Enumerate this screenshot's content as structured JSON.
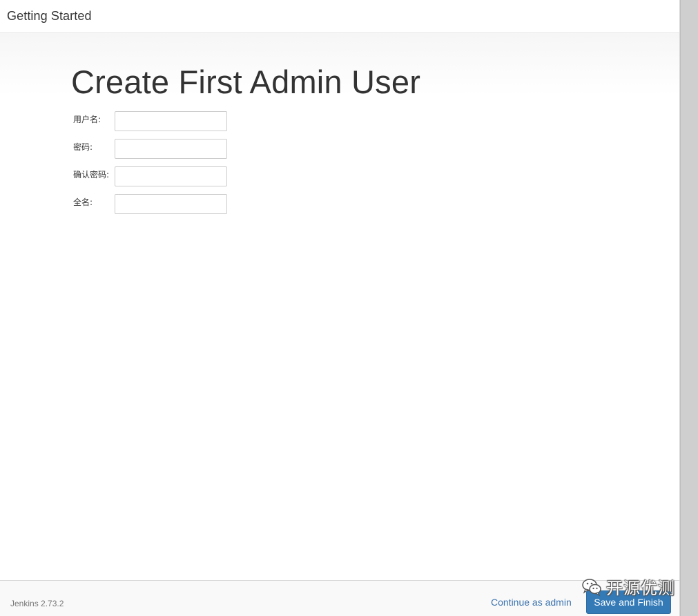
{
  "header": {
    "title": "Getting Started"
  },
  "main": {
    "title": "Create First Admin User",
    "form": {
      "fields": [
        {
          "label": "用户名:",
          "value": "",
          "placeholder": ""
        },
        {
          "label": "密码:",
          "value": "",
          "placeholder": ""
        },
        {
          "label": "确认密码:",
          "value": "",
          "placeholder": ""
        },
        {
          "label": "全名:",
          "value": "",
          "placeholder": ""
        }
      ]
    }
  },
  "footer": {
    "version": "Jenkins 2.73.2",
    "continue_label": "Continue as admin",
    "save_label": "Save and Finish"
  },
  "watermark": {
    "icon": "wechat-icon",
    "text": "开源优测"
  },
  "colors": {
    "primary_button": "#337ab7",
    "link": "#3b73af",
    "text": "#333333",
    "gutter": "#cfcfcf"
  }
}
